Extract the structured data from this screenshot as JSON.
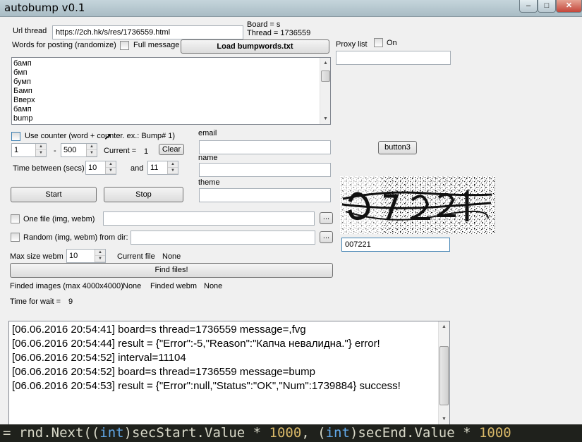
{
  "window": {
    "title": "autobump v0.1",
    "minimize": "–",
    "maximize": "□",
    "close": "✕"
  },
  "form": {
    "url_label": "Url thread",
    "url_value": "https://2ch.hk/s/res/1736559.html",
    "board_label": "Board   = s",
    "thread_label": "Thread = 1736559",
    "words_label": "Words for posting (randomize)",
    "full_message_label": "Full message",
    "load_button": "Load bumpwords.txt",
    "words": [
      "бамп",
      "бмп",
      "бумп",
      "Бамп",
      "Вверх",
      "бамп",
      "bump"
    ],
    "use_counter_label": "Use counter (word + counter. ex.: Bump# 1)",
    "counter_from": "1",
    "counter_dash": "-",
    "counter_to": "500",
    "current_label": "Current =",
    "current_value": "1",
    "clear_button": "Clear",
    "time_between_label": "Time between (secs)",
    "time_from": "10",
    "and_label": "and",
    "time_to": "11",
    "start_button": "Start",
    "stop_button": "Stop",
    "email_label": "email",
    "name_label": "name",
    "theme_label": "theme",
    "email_value": "",
    "name_value": "",
    "theme_value": "",
    "one_file_label": "One file (img, webm)",
    "one_file_value": "",
    "browse_label": "...",
    "random_label": "Random (img, webm) from dir:",
    "random_value": "",
    "max_size_label": "Max size webm",
    "max_size_value": "10",
    "current_file_label": "Current file",
    "current_file_value": "None",
    "find_files_button": "Find files!",
    "finded_images_label": "Finded images (max 4000x4000)",
    "finded_images_value": "None",
    "finded_webm_label": "Finded webm",
    "finded_webm_value": "None",
    "time_wait_label": "Time for wait =",
    "time_wait_value": "9",
    "proxy_label": "Proxy list",
    "proxy_on_label": "On",
    "proxy_value": "",
    "button3_label": "button3",
    "captcha_text": "007221"
  },
  "log": [
    "[06.06.2016 20:54:41] board=s thread=1736559 message=,fvg",
    "[06.06.2016 20:54:44] result = {\"Error\":-5,\"Reason\":\"Капча невалидна.\"} error!",
    "[06.06.2016 20:54:52] interval=11104",
    "[06.06.2016 20:54:52] board=s thread=1736559 message=bump",
    "[06.06.2016 20:54:53] result = {\"Error\":null,\"Status\":\"OK\",\"Num\":1739884} success!"
  ],
  "code": {
    "p1": "= rnd.Next((",
    "kw1": "int",
    "p2": ")secStart.Value * ",
    "n1": "1000",
    "p3": ", (",
    "kw2": "int",
    "p4": ")secEnd.Value * ",
    "n2": "1000"
  }
}
